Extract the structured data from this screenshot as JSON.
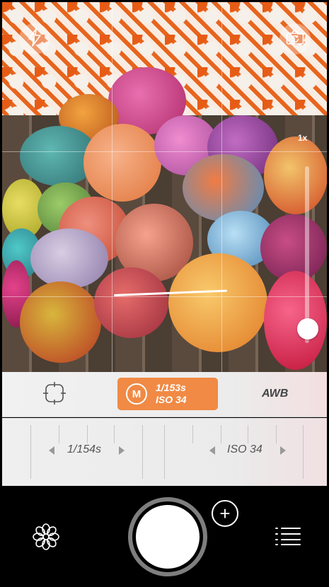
{
  "viewfinder": {
    "zoom_label": "1x",
    "flash_icon": "flash-icon",
    "flip_icon": "camera-flip-icon"
  },
  "mode_bar": {
    "focus_icon": "focus-frame-icon",
    "manual_badge": "M",
    "shutter_speed": "1/153s",
    "iso": "ISO 34",
    "white_balance": "AWB",
    "accent_color": "#f08a45"
  },
  "dials": {
    "shutter_value": "1/154s",
    "iso_value": "ISO 34"
  },
  "bottom_bar": {
    "add_label": "+",
    "filters_icon": "flower-icon",
    "menu_icon": "list-menu-icon"
  },
  "zoom": {
    "level": 0.08
  }
}
